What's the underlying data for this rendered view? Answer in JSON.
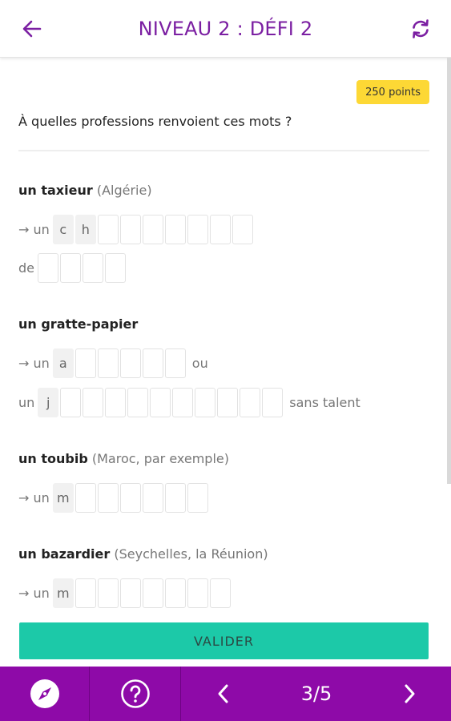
{
  "header": {
    "title": "NIVEAU 2 : DÉFI 2"
  },
  "points_badge": "250 points",
  "question": "À quelles professions renvoient ces mots ?",
  "items": [
    {
      "word": "un taxieur",
      "note": "(Algérie)",
      "lines": [
        {
          "prefix": "→ un",
          "letters": [
            "c",
            "h",
            "",
            "",
            "",
            "",
            "",
            "",
            ""
          ],
          "suffix": ""
        },
        {
          "prefix": "de",
          "letters": [
            "",
            "",
            "",
            ""
          ],
          "suffix": ""
        }
      ]
    },
    {
      "word": "un gratte-papier",
      "note": "",
      "lines": [
        {
          "prefix": "→ un",
          "letters": [
            "a",
            "",
            "",
            "",
            "",
            ""
          ],
          "suffix": "ou"
        },
        {
          "prefix": "un",
          "letters": [
            "j",
            "",
            "",
            "",
            "",
            "",
            "",
            "",
            "",
            "",
            ""
          ],
          "suffix": "sans talent"
        }
      ]
    },
    {
      "word": "un toubib",
      "note": "(Maroc, par exemple)",
      "lines": [
        {
          "prefix": "→ un",
          "letters": [
            "m",
            "",
            "",
            "",
            "",
            "",
            ""
          ],
          "suffix": ""
        }
      ]
    },
    {
      "word": "un bazardier",
      "note": "(Seychelles, la Réunion)",
      "lines": [
        {
          "prefix": "→ un",
          "letters": [
            "m",
            "",
            "",
            "",
            "",
            "",
            "",
            ""
          ],
          "suffix": ""
        }
      ]
    }
  ],
  "validate_label": "VALIDER",
  "bottom_nav": {
    "page_indicator": "3/5"
  },
  "colors": {
    "accent_purple": "#7b1fa2",
    "nav_purple": "#8e0aa8",
    "validate_teal": "#1cc9a8",
    "badge_yellow": "#fdd835"
  },
  "icons": [
    "back-arrow-icon",
    "refresh-icon",
    "compass-icon",
    "help-icon",
    "chevron-left-icon",
    "chevron-right-icon"
  ]
}
